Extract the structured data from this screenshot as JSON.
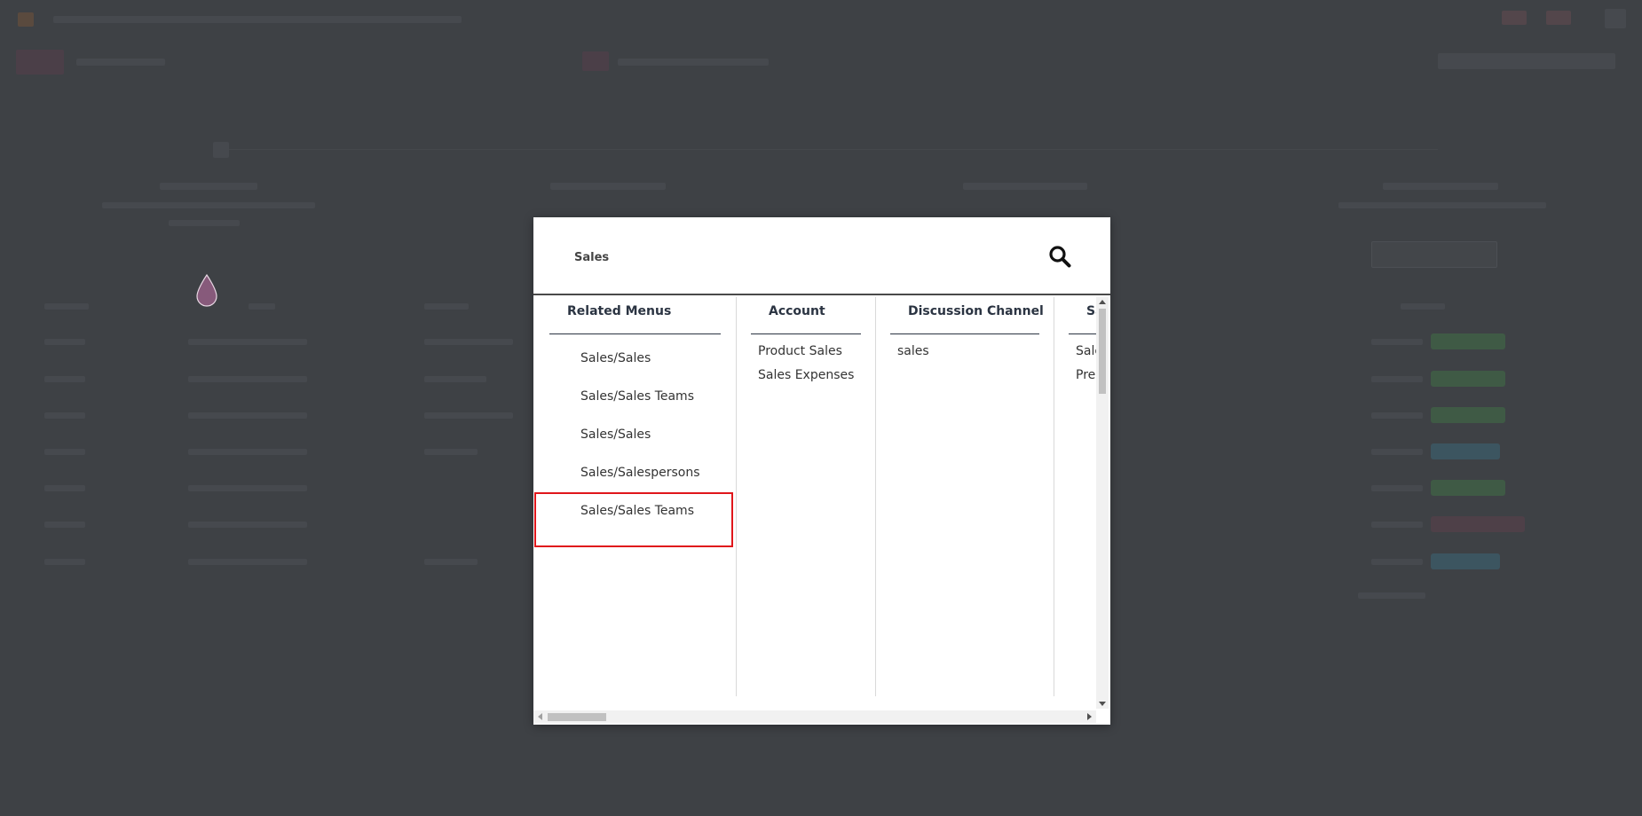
{
  "search": {
    "value": "Sales"
  },
  "columns": {
    "related_menus": {
      "title": "Related Menus",
      "items": [
        "Sales/Sales",
        "Sales/Sales Teams",
        "Sales/Sales",
        "Sales/Salespersons",
        "Sales/Sales Teams"
      ]
    },
    "account": {
      "title": "Account",
      "items": [
        "Product Sales",
        "Sales Expenses"
      ]
    },
    "discussion_channel": {
      "title": "Discussion Channel",
      "items": [
        "sales"
      ]
    },
    "sales_partial": {
      "title": "Sa",
      "items": [
        "Sale",
        "Pre"
      ]
    }
  },
  "colors": {
    "backdrop": "#3e4145",
    "highlight": "#e0161b",
    "heading": "#2b3442",
    "brand": "#875a7b"
  },
  "icons": {
    "search": "search-icon",
    "brand": "drop-icon"
  }
}
